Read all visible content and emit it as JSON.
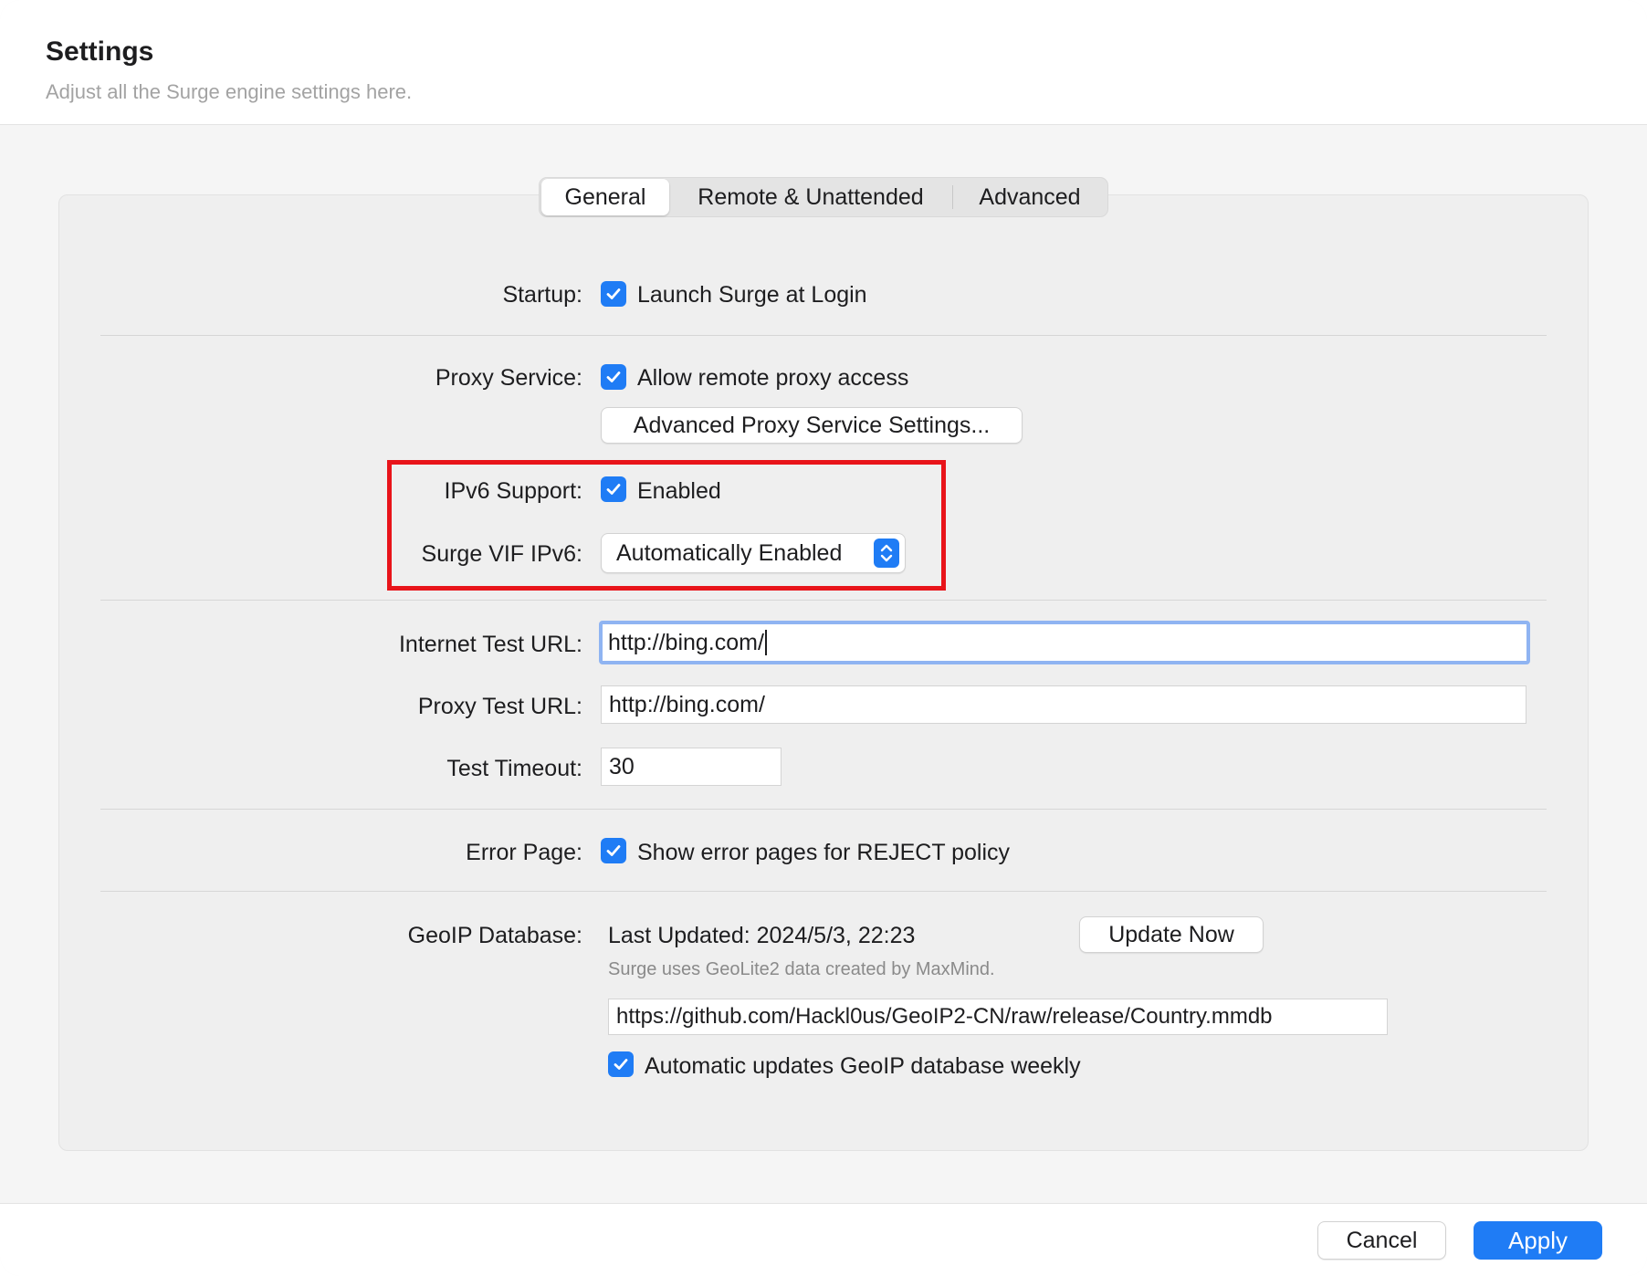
{
  "header": {
    "title": "Settings",
    "subtitle": "Adjust all the Surge engine settings here."
  },
  "tabs": [
    {
      "label": "General",
      "active": true
    },
    {
      "label": "Remote & Unattended",
      "active": false
    },
    {
      "label": "Advanced",
      "active": false
    }
  ],
  "startup": {
    "label": "Startup:",
    "checkbox_label": "Launch Surge at Login",
    "checked": true
  },
  "proxy_service": {
    "label": "Proxy Service:",
    "checkbox_label": "Allow remote proxy access",
    "checked": true,
    "button_label": "Advanced Proxy Service Settings..."
  },
  "ipv6": {
    "label": "IPv6 Support:",
    "checkbox_label": "Enabled",
    "checked": true
  },
  "vif_ipv6": {
    "label": "Surge VIF IPv6:",
    "selected": "Automatically Enabled"
  },
  "internet_test": {
    "label": "Internet Test URL:",
    "value": "http://bing.com/"
  },
  "proxy_test": {
    "label": "Proxy Test URL:",
    "value": "http://bing.com/"
  },
  "timeout": {
    "label": "Test Timeout:",
    "value": "30"
  },
  "error_page": {
    "label": "Error Page:",
    "checkbox_label": "Show error pages for REJECT policy",
    "checked": true
  },
  "geoip": {
    "label": "GeoIP Database:",
    "last_updated": "Last Updated: 2024/5/3, 22:23",
    "update_button": "Update Now",
    "note": "Surge uses GeoLite2 data created by MaxMind.",
    "url": "https://github.com/Hackl0us/GeoIP2-CN/raw/release/Country.mmdb",
    "auto_update_label": "Automatic updates GeoIP database weekly",
    "auto_update_checked": true
  },
  "footer": {
    "cancel_label": "Cancel",
    "apply_label": "Apply"
  },
  "colors": {
    "accent": "#1f7cf5",
    "highlight": "#e8141a"
  },
  "icons": {
    "checkbox": "checkmark-icon",
    "select": "up-down-chevron-icon"
  }
}
